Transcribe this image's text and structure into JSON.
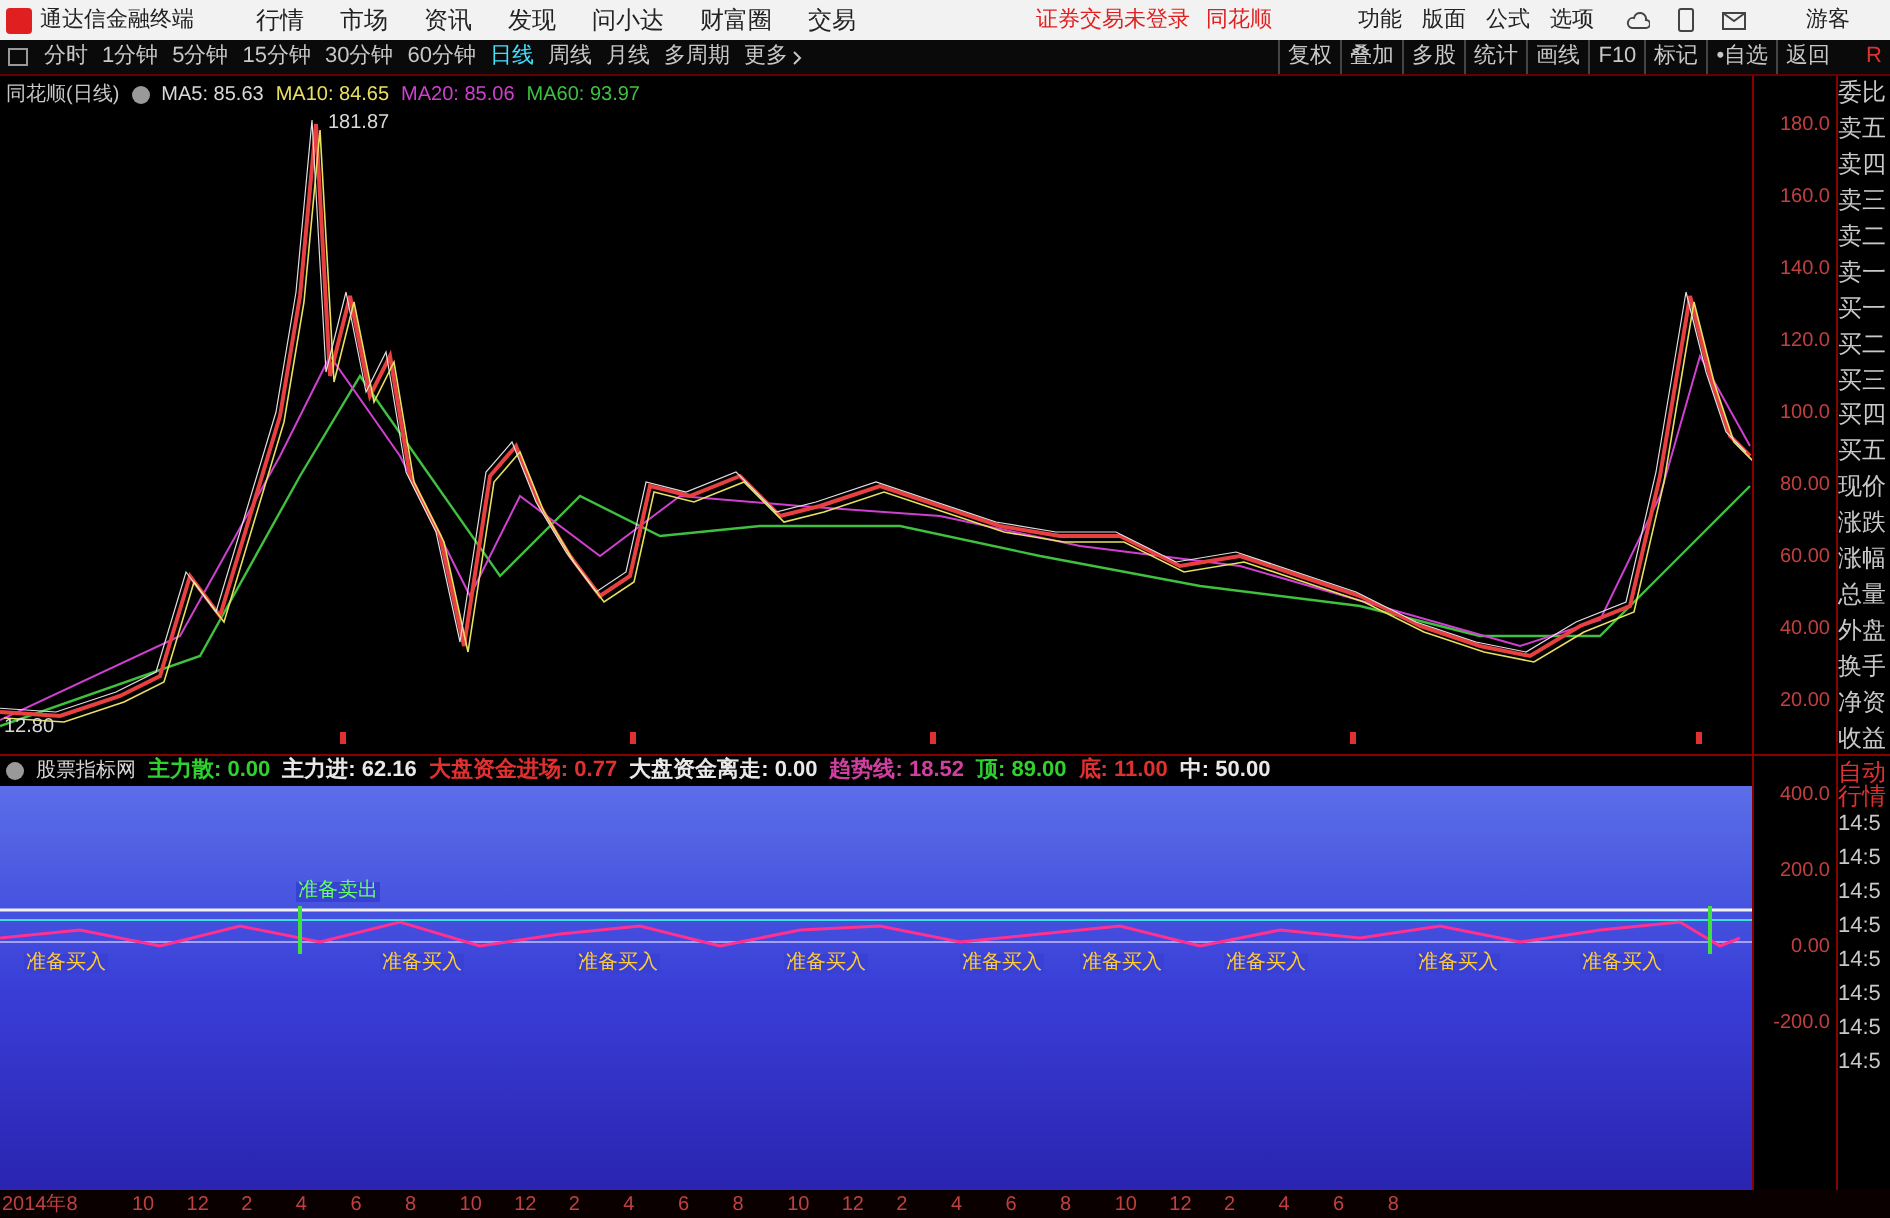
{
  "app": {
    "title": "通达信金融终端"
  },
  "menu": [
    "行情",
    "市场",
    "资讯",
    "发现",
    "问小达",
    "财富圈",
    "交易"
  ],
  "login_status": [
    "证券交易未登录",
    "同花顺"
  ],
  "tools": [
    "功能",
    "版面",
    "公式",
    "选项"
  ],
  "user": "游客",
  "periods": [
    {
      "label": "分时",
      "selected": false
    },
    {
      "label": "1分钟",
      "selected": false
    },
    {
      "label": "5分钟",
      "selected": false
    },
    {
      "label": "15分钟",
      "selected": false
    },
    {
      "label": "30分钟",
      "selected": false
    },
    {
      "label": "60分钟",
      "selected": false
    },
    {
      "label": "日线",
      "selected": true
    },
    {
      "label": "周线",
      "selected": false
    },
    {
      "label": "月线",
      "selected": false
    },
    {
      "label": "多周期",
      "selected": false
    }
  ],
  "more": "更多",
  "actions": [
    "复权",
    "叠加",
    "多股",
    "统计",
    "画线",
    "F10",
    "标记",
    "•自选",
    "返回"
  ],
  "corner": "R",
  "chart": {
    "title": "同花顺(日线)",
    "ma": [
      {
        "label": "MA5:",
        "value": "85.63",
        "color": "#d8d8d8"
      },
      {
        "label": "MA10:",
        "value": "84.65",
        "color": "#e8e060"
      },
      {
        "label": "MA20:",
        "value": "85.06",
        "color": "#d040d0"
      },
      {
        "label": "MA60:",
        "value": "93.97",
        "color": "#40c040"
      }
    ],
    "high_label": "181.87",
    "low_label": "12.80",
    "yticks": [
      "180.0",
      "160.0",
      "140.0",
      "120.0",
      "100.0",
      "80.00",
      "60.00",
      "40.00",
      "20.00"
    ]
  },
  "indicator": {
    "title": "股票指标网",
    "values": [
      {
        "label": "主力散:",
        "value": "0.00",
        "color": "#30d030"
      },
      {
        "label": "主力进:",
        "value": "62.16",
        "color": "#e8e8e8"
      },
      {
        "label": "大盘资金进场:",
        "value": "0.77",
        "color": "#e03030"
      },
      {
        "label": "大盘资金离走:",
        "value": "0.00",
        "color": "#e8e8e8"
      },
      {
        "label": "趋势线:",
        "value": "18.52",
        "color": "#d040a0"
      },
      {
        "label": "顶:",
        "value": "89.00",
        "color": "#30d030"
      },
      {
        "label": "底:",
        "value": "11.00",
        "color": "#e03030"
      },
      {
        "label": "中:",
        "value": "50.00",
        "color": "#e8e8e8"
      }
    ],
    "yticks": [
      "400.0",
      "200.0",
      "0.00",
      "-200.0"
    ],
    "signals": [
      {
        "text": "准备卖出",
        "kind": "sell"
      },
      {
        "text": "准备买入",
        "kind": "buy"
      },
      {
        "text": "准备买入",
        "kind": "buy"
      },
      {
        "text": "准备买入",
        "kind": "buy"
      },
      {
        "text": "准备买入",
        "kind": "buy"
      },
      {
        "text": "准备买入",
        "kind": "buy"
      },
      {
        "text": "准备买入",
        "kind": "buy"
      },
      {
        "text": "准备买入",
        "kind": "buy"
      },
      {
        "text": "准备买入",
        "kind": "buy"
      },
      {
        "text": "准备买入",
        "kind": "buy"
      }
    ]
  },
  "quote_panel": {
    "fields": [
      "委比",
      "卖五",
      "卖四",
      "卖三",
      "卖二",
      "卖一",
      "买一",
      "买二",
      "买三",
      "买四",
      "买五",
      "现价",
      "涨跌",
      "涨幅",
      "总量",
      "外盘",
      "换手",
      "净资",
      "收益"
    ],
    "mode": [
      "自动",
      "行情"
    ],
    "times": [
      "14:5",
      "14:5",
      "14:5",
      "14:5",
      "14:5",
      "14:5",
      "14:5",
      "14:5"
    ]
  },
  "xaxis": [
    "2014年8",
    "10",
    "12",
    "2",
    "4",
    "6",
    "8",
    "10",
    "12",
    "2",
    "4",
    "6",
    "8",
    "10",
    "12",
    "2",
    "4",
    "6",
    "8",
    "10",
    "12",
    "2",
    "4",
    "6",
    "8"
  ]
}
